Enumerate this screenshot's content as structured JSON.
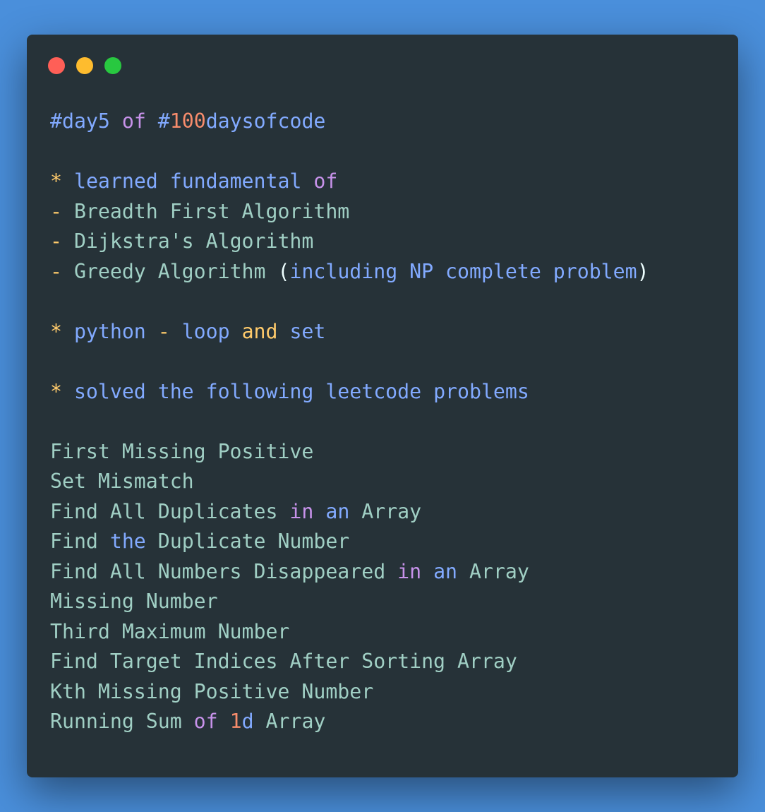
{
  "colors": {
    "page_background": "#4a8fdb",
    "window_background": "#263238",
    "close_dot": "#ff5f57",
    "minimize_dot": "#febc2e",
    "zoom_dot": "#28c840",
    "token_colors": {
      "cyan": "#89ddff",
      "text": "#a0cfc4",
      "blue": "#82aaff",
      "purple": "#c792ea",
      "orange": "#f78c6c",
      "yellow": "#ffcb6b",
      "white": "#eeffff",
      "red": "#ff5370"
    }
  },
  "window_controls": [
    "close",
    "minimize",
    "zoom"
  ],
  "code_lines": [
    [
      {
        "text": "#day5",
        "color": "blue"
      },
      {
        "text": " ",
        "color": "text"
      },
      {
        "text": "of",
        "color": "purple"
      },
      {
        "text": " ",
        "color": "text"
      },
      {
        "text": "#",
        "color": "blue"
      },
      {
        "text": "100",
        "color": "orange"
      },
      {
        "text": "daysofcode",
        "color": "blue"
      }
    ],
    [],
    [
      {
        "text": "*",
        "color": "yellow"
      },
      {
        "text": " ",
        "color": "text"
      },
      {
        "text": "learned fundamental",
        "color": "blue"
      },
      {
        "text": " ",
        "color": "text"
      },
      {
        "text": "of",
        "color": "purple"
      }
    ],
    [
      {
        "text": "-",
        "color": "yellow"
      },
      {
        "text": " Breadth First Algorithm",
        "color": "text"
      }
    ],
    [
      {
        "text": "-",
        "color": "yellow"
      },
      {
        "text": " Dijkstra's Algorithm",
        "color": "text"
      }
    ],
    [
      {
        "text": "-",
        "color": "yellow"
      },
      {
        "text": " Greedy Algorithm ",
        "color": "text"
      },
      {
        "text": "(",
        "color": "white"
      },
      {
        "text": "including NP complete problem",
        "color": "blue"
      },
      {
        "text": ")",
        "color": "white"
      }
    ],
    [],
    [
      {
        "text": "*",
        "color": "yellow"
      },
      {
        "text": " python ",
        "color": "blue"
      },
      {
        "text": "-",
        "color": "yellow"
      },
      {
        "text": " loop ",
        "color": "blue"
      },
      {
        "text": "and",
        "color": "yellow"
      },
      {
        "text": " set",
        "color": "blue"
      }
    ],
    [],
    [
      {
        "text": "*",
        "color": "yellow"
      },
      {
        "text": " solved the following leetcode problems",
        "color": "blue"
      }
    ],
    [],
    [
      {
        "text": "First Missing Positive",
        "color": "text"
      }
    ],
    [
      {
        "text": "Set Mismatch",
        "color": "text"
      }
    ],
    [
      {
        "text": "Find All Duplicates ",
        "color": "text"
      },
      {
        "text": "in",
        "color": "purple"
      },
      {
        "text": " ",
        "color": "text"
      },
      {
        "text": "an",
        "color": "blue"
      },
      {
        "text": " Array",
        "color": "text"
      }
    ],
    [
      {
        "text": "Find ",
        "color": "text"
      },
      {
        "text": "the",
        "color": "blue"
      },
      {
        "text": " Duplicate Number",
        "color": "text"
      }
    ],
    [
      {
        "text": "Find All Numbers Disappeared ",
        "color": "text"
      },
      {
        "text": "in",
        "color": "purple"
      },
      {
        "text": " ",
        "color": "text"
      },
      {
        "text": "an",
        "color": "blue"
      },
      {
        "text": " Array",
        "color": "text"
      }
    ],
    [
      {
        "text": "Missing Number",
        "color": "text"
      }
    ],
    [
      {
        "text": "Third Maximum Number",
        "color": "text"
      }
    ],
    [
      {
        "text": "Find Target Indices After Sorting Array",
        "color": "text"
      }
    ],
    [
      {
        "text": "Kth Missing Positive Number",
        "color": "text"
      }
    ],
    [
      {
        "text": "Running Sum ",
        "color": "text"
      },
      {
        "text": "of",
        "color": "purple"
      },
      {
        "text": " ",
        "color": "text"
      },
      {
        "text": "1",
        "color": "orange"
      },
      {
        "text": "d",
        "color": "blue"
      },
      {
        "text": " Array",
        "color": "text"
      }
    ]
  ]
}
